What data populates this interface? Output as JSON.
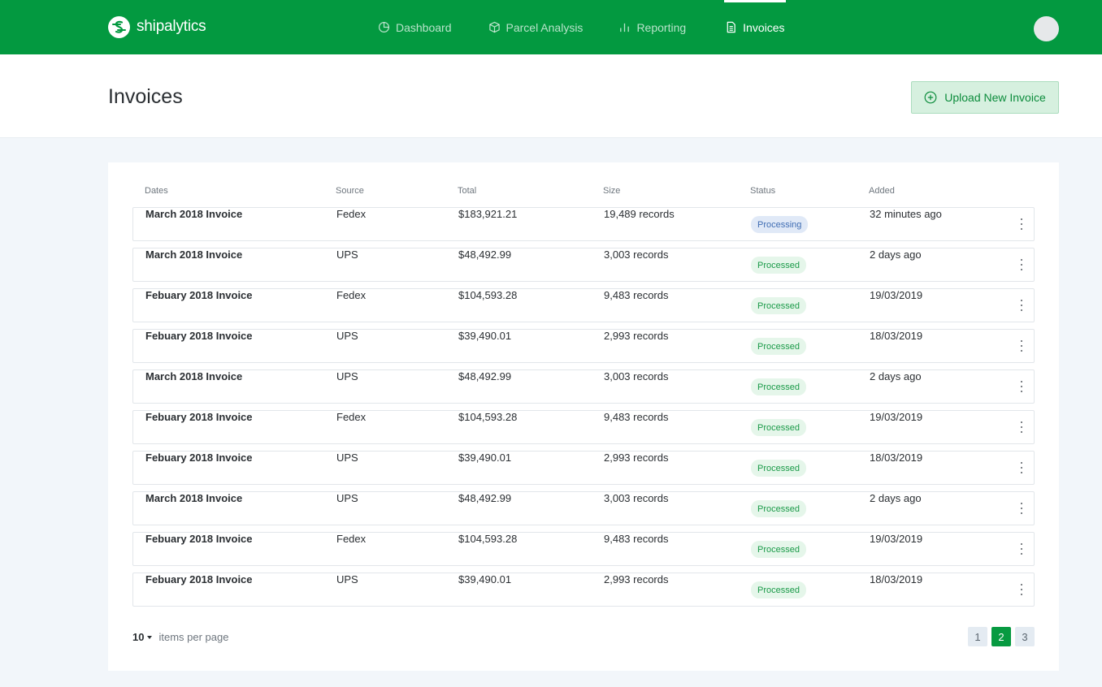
{
  "app": {
    "brand": "shipalytics",
    "colors": {
      "primary": "#039940",
      "processing": "#3f6db3",
      "processed": "#1a9a48"
    }
  },
  "nav": {
    "items": [
      {
        "label": "Dashboard",
        "icon": "pie-chart-icon"
      },
      {
        "label": "Parcel Analysis",
        "icon": "box-icon"
      },
      {
        "label": "Reporting",
        "icon": "bar-chart-icon"
      },
      {
        "label": "Invoices",
        "icon": "document-icon",
        "active": true
      }
    ]
  },
  "header": {
    "title": "Invoices",
    "upload_label": "Upload New Invoice"
  },
  "table": {
    "columns": [
      "Dates",
      "Source",
      "Total",
      "Size",
      "Status",
      "Added"
    ],
    "rows": [
      {
        "name": "March 2018 Invoice",
        "source": "Fedex",
        "total": "$183,921.21",
        "size": "19,489 records",
        "status": "Processing",
        "added": "32 minutes ago"
      },
      {
        "name": "March 2018 Invoice",
        "source": "UPS",
        "total": "$48,492.99",
        "size": "3,003 records",
        "status": "Processed",
        "added": "2 days ago"
      },
      {
        "name": "Febuary 2018 Invoice",
        "source": "Fedex",
        "total": "$104,593.28",
        "size": "9,483 records",
        "status": "Processed",
        "added": "19/03/2019"
      },
      {
        "name": "Febuary 2018 Invoice",
        "source": "UPS",
        "total": "$39,490.01",
        "size": "2,993 records",
        "status": "Processed",
        "added": "18/03/2019"
      },
      {
        "name": "March 2018 Invoice",
        "source": "UPS",
        "total": "$48,492.99",
        "size": "3,003 records",
        "status": "Processed",
        "added": "2 days ago"
      },
      {
        "name": "Febuary 2018 Invoice",
        "source": "Fedex",
        "total": "$104,593.28",
        "size": "9,483 records",
        "status": "Processed",
        "added": "19/03/2019"
      },
      {
        "name": "Febuary 2018 Invoice",
        "source": "UPS",
        "total": "$39,490.01",
        "size": "2,993 records",
        "status": "Processed",
        "added": "18/03/2019"
      },
      {
        "name": "March 2018 Invoice",
        "source": "UPS",
        "total": "$48,492.99",
        "size": "3,003 records",
        "status": "Processed",
        "added": "2 days ago"
      },
      {
        "name": "Febuary 2018 Invoice",
        "source": "Fedex",
        "total": "$104,593.28",
        "size": "9,483 records",
        "status": "Processed",
        "added": "19/03/2019"
      },
      {
        "name": "Febuary 2018 Invoice",
        "source": "UPS",
        "total": "$39,490.01",
        "size": "2,993 records",
        "status": "Processed",
        "added": "18/03/2019"
      }
    ]
  },
  "pagination": {
    "per_page": "10",
    "per_page_label": "items per page",
    "pages": [
      "1",
      "2",
      "3"
    ],
    "current": "2"
  }
}
